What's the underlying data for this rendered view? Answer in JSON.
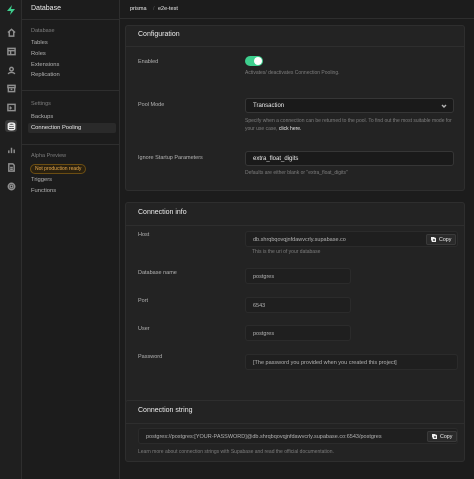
{
  "sidebar_menu": {
    "title": "Database",
    "sections": [
      {
        "label": "Database",
        "items": [
          "Tables",
          "Roles",
          "Extensions",
          "Replication"
        ]
      },
      {
        "label": "Settings",
        "items": [
          "Backups",
          "Connection Pooling"
        ]
      },
      {
        "label": "Alpha Preview",
        "badge": "Not production ready",
        "items": [
          "Triggers",
          "Functions"
        ]
      }
    ],
    "active_item": "Connection Pooling"
  },
  "breadcrumb": {
    "org": "prisma",
    "project": "e2e-test"
  },
  "configuration": {
    "title": "Configuration",
    "enabled_label": "Enabled",
    "enabled_help": "Activates/ deactivates Connection Pooling.",
    "enabled_value": true,
    "pool_mode_label": "Pool Mode",
    "pool_mode_value": "Transaction",
    "pool_mode_help": "Specify when a connection can be returned to the pool. To find out the most suitable mode for your use case,",
    "pool_mode_link": "click here.",
    "ignore_params_label": "Ignore Startup Parameters",
    "ignore_params_value": "extra_float_digits",
    "ignore_params_help": "Defaults are either blank or \"extra_float_digits\""
  },
  "connection_info": {
    "title": "Connection info",
    "host_label": "Host",
    "host_value": "db.shrqbqovqjnfdawvcrly.supabase.co",
    "host_help": "This is the uri of your database",
    "dbname_label": "Database name",
    "dbname_value": "postgres",
    "port_label": "Port",
    "port_value": "6543",
    "user_label": "User",
    "user_value": "postgres",
    "password_label": "Password",
    "password_value": "[The password you provided when you created this project]",
    "copy_label": "Copy"
  },
  "connection_string": {
    "title": "Connection string",
    "value": "postgres://postgres:[YOUR-PASSWORD]@db.shrqbqovqjnfdawvcrly.supabase.co:6543/postgres",
    "copy_label": "Copy",
    "help": "Learn more about connection strings with Supabase and read the official documentation."
  },
  "colors": {
    "accent": "#3ecf8e",
    "badge": "#e8a94a",
    "background": "#1c1c1c",
    "panel": "#232323"
  }
}
